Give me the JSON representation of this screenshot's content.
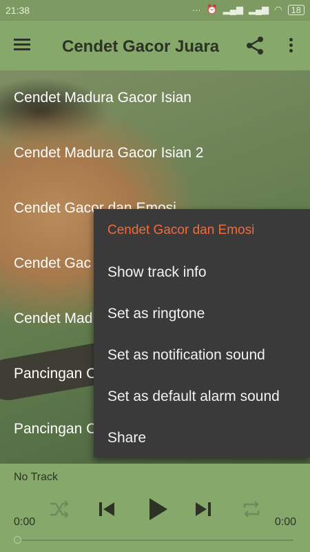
{
  "status_bar": {
    "time": "21:38",
    "battery": "18"
  },
  "app_bar": {
    "title": "Cendet Gacor Juara"
  },
  "tracks": [
    {
      "label": "Cendet Madura Gacor Isian"
    },
    {
      "label": "Cendet Madura Gacor Isian 2"
    },
    {
      "label": "Cendet Gacor dan Emosi"
    },
    {
      "label": "Cendet Gac"
    },
    {
      "label": "Cendet Mad"
    },
    {
      "label": "Pancingan C"
    },
    {
      "label": "Pancingan C"
    }
  ],
  "context_menu": {
    "title": "Cendet Gacor dan Emosi",
    "items": [
      {
        "label": "Show track info"
      },
      {
        "label": "Set as ringtone"
      },
      {
        "label": "Set as notification sound"
      },
      {
        "label": "Set as default alarm sound"
      },
      {
        "label": "Share"
      }
    ]
  },
  "player": {
    "track_label": "No Track",
    "elapsed": "0:00",
    "duration": "0:00",
    "progress": 0
  },
  "colors": {
    "app_bar": "#86a86b",
    "menu_bg": "#3a3a3a",
    "menu_title": "#f26b3a",
    "text_dark": "#2c3324"
  }
}
